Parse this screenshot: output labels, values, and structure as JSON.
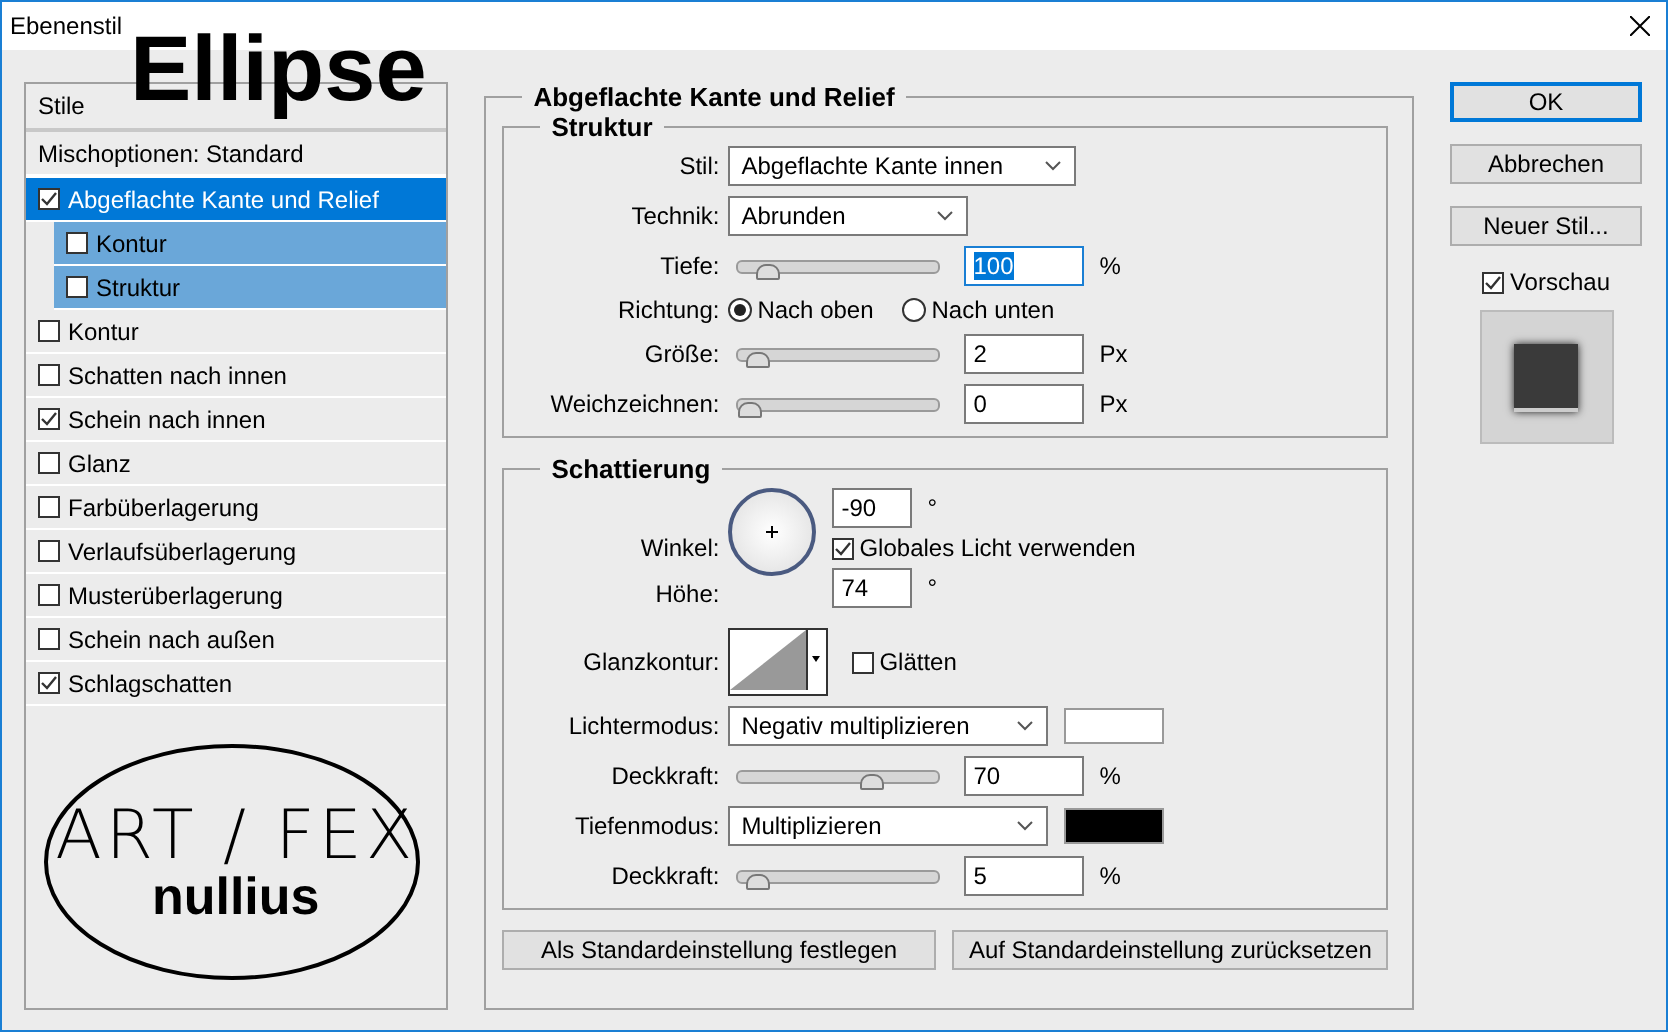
{
  "window": {
    "title": "Ebenenstil"
  },
  "overlay_title": "Ellipse",
  "styles_panel": {
    "header": "Stile",
    "blend_options": "Mischoptionen: Standard",
    "items": [
      {
        "label": "Abgeflachte Kante und Relief",
        "checked": true,
        "selected": true,
        "children": [
          {
            "label": "Kontur",
            "checked": false,
            "selected": false
          },
          {
            "label": "Struktur",
            "checked": false,
            "selected": false
          }
        ]
      },
      {
        "label": "Kontur",
        "checked": false,
        "selected": false
      },
      {
        "label": "Schatten nach innen",
        "checked": false,
        "selected": false
      },
      {
        "label": "Schein nach innen",
        "checked": true,
        "selected": false
      },
      {
        "label": "Glanz",
        "checked": false,
        "selected": false
      },
      {
        "label": "Farbüberlagerung",
        "checked": false,
        "selected": false
      },
      {
        "label": "Verlaufsüberlagerung",
        "checked": false,
        "selected": false
      },
      {
        "label": "Musterüberlagerung",
        "checked": false,
        "selected": false
      },
      {
        "label": "Schein nach außen",
        "checked": false,
        "selected": false
      },
      {
        "label": "Schlagschatten",
        "checked": true,
        "selected": false
      }
    ],
    "logo": {
      "top": "ART / FEX",
      "bottom": "nullius"
    }
  },
  "main": {
    "title": "Abgeflachte Kante und Relief",
    "structure": {
      "title": "Struktur",
      "rows": [
        {
          "kind": "select",
          "label": "Stil:",
          "value": "Abgeflachte Kante innen"
        },
        {
          "kind": "select",
          "label": "Technik:",
          "value": "Abrunden"
        },
        {
          "kind": "slider",
          "label": "Tiefe:",
          "level": 0.1,
          "value": "100",
          "unit": "%",
          "focused": true
        },
        {
          "kind": "radio",
          "label": "Richtung:",
          "options": [
            {
              "label": "Nach oben",
              "selected": true
            },
            {
              "label": "Nach unten",
              "selected": false
            }
          ]
        },
        {
          "kind": "slider",
          "label": "Größe:",
          "level": 0.05,
          "value": "2",
          "unit": "Px",
          "focused": false
        },
        {
          "kind": "slider",
          "label": "Weichzeichnen:",
          "level": 0,
          "value": "0",
          "unit": "Px",
          "focused": false
        }
      ]
    },
    "shading": {
      "title": "Schattierung",
      "angle": {
        "label": "Winkel:",
        "value": "-90",
        "unit": "°"
      },
      "global_light": {
        "label": "Globales Licht verwenden",
        "checked": true
      },
      "altitude": {
        "label": "Höhe:",
        "value": "74",
        "unit": "°"
      },
      "gloss": {
        "label": "Glanzkontur:",
        "smooth_label": "Glätten",
        "smooth_checked": false
      },
      "rows": [
        {
          "kind": "select",
          "label": "Lichtermodus:",
          "value": "Negativ multiplizieren",
          "color": "#ffffff"
        },
        {
          "kind": "slider",
          "label": "Deckkraft:",
          "level": 0.7,
          "value": "70",
          "unit": "%",
          "focused": false
        },
        {
          "kind": "select",
          "label": "Tiefenmodus:",
          "value": "Multiplizieren",
          "color": "#000000"
        },
        {
          "kind": "slider",
          "label": "Deckkraft:",
          "level": 0.05,
          "value": "5",
          "unit": "%",
          "focused": false
        }
      ]
    },
    "buttons": [
      "Als Standardeinstellung festlegen",
      "Auf Standardeinstellung zurücksetzen"
    ]
  },
  "side": {
    "buttons": [
      {
        "label": "OK",
        "default": true
      },
      {
        "label": "Abbrechen",
        "default": false
      },
      {
        "label": "Neuer Stil...",
        "default": false
      }
    ],
    "preview": {
      "label": "Vorschau",
      "checked": true
    }
  }
}
